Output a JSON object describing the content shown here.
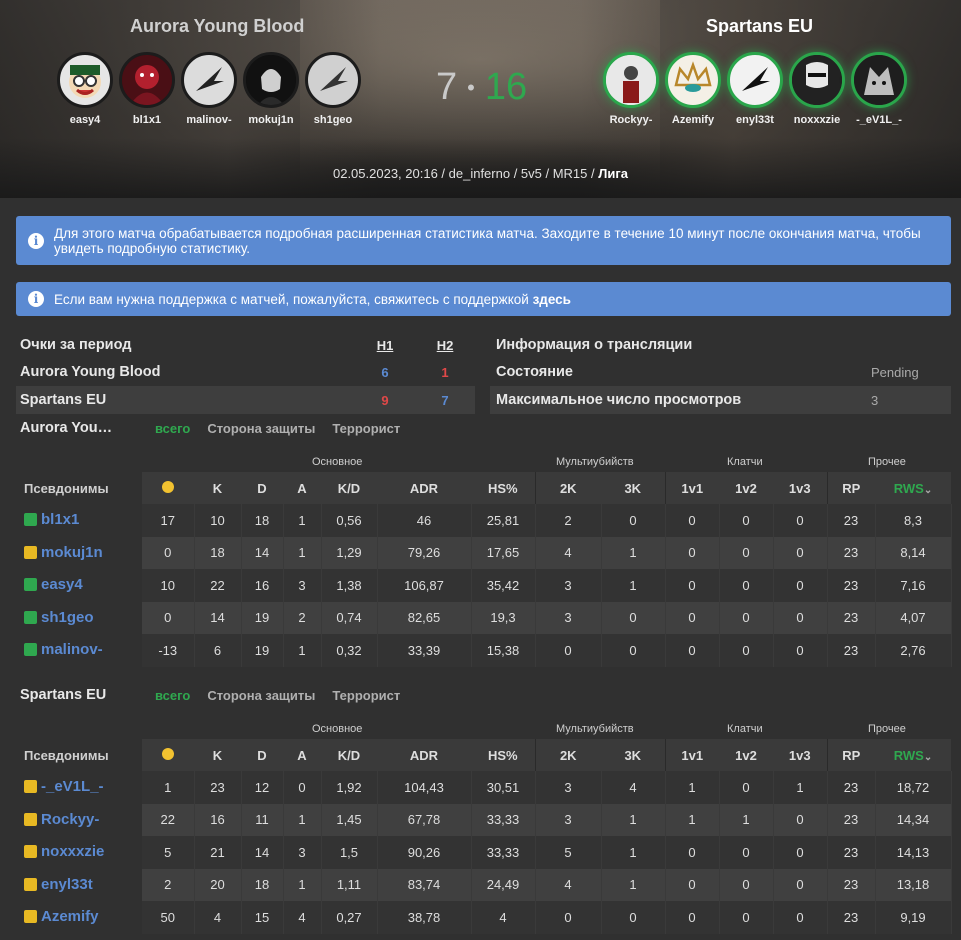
{
  "header": {
    "team_left": "Aurora Young Blood",
    "team_right": "Spartans EU",
    "score_left": "7",
    "score_sep": "•",
    "score_right": "16",
    "meta": "02.05.2023, 20:16 / de_inferno / 5v5 / MR15 / ",
    "meta_bold": "Лига",
    "players_left": [
      "easy4",
      "bl1x1",
      "malinov-",
      "mokuj1n",
      "sh1geo"
    ],
    "players_right": [
      "Rockyy-",
      "Azemify",
      "enyl33t",
      "noxxxzie",
      "-_eV1L_-"
    ]
  },
  "alerts": {
    "info_icon": "i",
    "stats_notice": "Для этого матча обрабатывается подробная расширенная статистика матча. Заходите в течение 10 минут после окончания матча, чтобы увидеть подробную статистику.",
    "support_text": "Если вам нужна поддержка с матчей, пожалуйста, свяжитесь с поддержкой ",
    "support_link": "здесь"
  },
  "period": {
    "title": "Очки за период",
    "h1": "H1",
    "h2": "H2",
    "rows": [
      {
        "team": "Aurora Young Blood",
        "h1": "6",
        "h2": "1"
      },
      {
        "team": "Spartans EU",
        "h1": "9",
        "h2": "7"
      }
    ]
  },
  "broadcast": {
    "title": "Информация о трансляции",
    "status_label": "Состояние",
    "status_value": "Pending",
    "views_label": "Максимальное число просмотров",
    "views_value": "3"
  },
  "table_labels": {
    "tab_all": "всего",
    "tab_ct": "Сторона защиты",
    "tab_t": "Террорист",
    "group_main": "Основное",
    "group_multi": "Мультиубийств",
    "group_clutch": "Клатчи",
    "group_other": "Прочее",
    "col_nick": "Псевдонимы",
    "col_k": "K",
    "col_d": "D",
    "col_a": "A",
    "col_kd": "K/D",
    "col_adr": "ADR",
    "col_hs": "HS%",
    "col_2k": "2K",
    "col_3k": "3K",
    "col_1v1": "1v1",
    "col_1v2": "1v2",
    "col_1v3": "1v3",
    "col_rp": "RP",
    "col_rws": "RWS",
    "sort_icon": "⌄"
  },
  "team1": {
    "name": "Aurora You…",
    "rows": [
      {
        "nick": "bl1x1",
        "rank": "green",
        "sm": "17",
        "k": "10",
        "d": "18",
        "a": "1",
        "kd": "0,56",
        "adr": "46",
        "hs": "25,81",
        "k2": "2",
        "k3": "0",
        "c1": "0",
        "c2": "0",
        "c3": "0",
        "rp": "23",
        "rws": "8,3"
      },
      {
        "nick": "mokuj1n",
        "rank": "yellow",
        "sm": "0",
        "k": "18",
        "d": "14",
        "a": "1",
        "kd": "1,29",
        "adr": "79,26",
        "hs": "17,65",
        "k2": "4",
        "k3": "1",
        "c1": "0",
        "c2": "0",
        "c3": "0",
        "rp": "23",
        "rws": "8,14"
      },
      {
        "nick": "easy4",
        "rank": "green",
        "sm": "10",
        "k": "22",
        "d": "16",
        "a": "3",
        "kd": "1,38",
        "adr": "106,87",
        "hs": "35,42",
        "k2": "3",
        "k3": "1",
        "c1": "0",
        "c2": "0",
        "c3": "0",
        "rp": "23",
        "rws": "7,16"
      },
      {
        "nick": "sh1geo",
        "rank": "green",
        "sm": "0",
        "k": "14",
        "d": "19",
        "a": "2",
        "kd": "0,74",
        "adr": "82,65",
        "hs": "19,3",
        "k2": "3",
        "k3": "0",
        "c1": "0",
        "c2": "0",
        "c3": "0",
        "rp": "23",
        "rws": "4,07"
      },
      {
        "nick": "malinov-",
        "rank": "green",
        "sm": "-13",
        "k": "6",
        "d": "19",
        "a": "1",
        "kd": "0,32",
        "adr": "33,39",
        "hs": "15,38",
        "k2": "0",
        "k3": "0",
        "c1": "0",
        "c2": "0",
        "c3": "0",
        "rp": "23",
        "rws": "2,76"
      }
    ]
  },
  "team2": {
    "name": "Spartans EU",
    "rows": [
      {
        "nick": "-_eV1L_-",
        "rank": "yellow",
        "sm": "1",
        "k": "23",
        "d": "12",
        "a": "0",
        "kd": "1,92",
        "adr": "104,43",
        "hs": "30,51",
        "k2": "3",
        "k3": "4",
        "c1": "1",
        "c2": "0",
        "c3": "1",
        "rp": "23",
        "rws": "18,72"
      },
      {
        "nick": "Rockyy-",
        "rank": "yellow",
        "sm": "22",
        "k": "16",
        "d": "11",
        "a": "1",
        "kd": "1,45",
        "adr": "67,78",
        "hs": "33,33",
        "k2": "3",
        "k3": "1",
        "c1": "1",
        "c2": "1",
        "c3": "0",
        "rp": "23",
        "rws": "14,34"
      },
      {
        "nick": "noxxxzie",
        "rank": "yellow",
        "sm": "5",
        "k": "21",
        "d": "14",
        "a": "3",
        "kd": "1,5",
        "adr": "90,26",
        "hs": "33,33",
        "k2": "5",
        "k3": "1",
        "c1": "0",
        "c2": "0",
        "c3": "0",
        "rp": "23",
        "rws": "14,13"
      },
      {
        "nick": "enyl33t",
        "rank": "yellow",
        "sm": "2",
        "k": "20",
        "d": "18",
        "a": "1",
        "kd": "1,11",
        "adr": "83,74",
        "hs": "24,49",
        "k2": "4",
        "k3": "1",
        "c1": "0",
        "c2": "0",
        "c3": "0",
        "rp": "23",
        "rws": "13,18"
      },
      {
        "nick": "Azemify",
        "rank": "yellow",
        "sm": "50",
        "k": "4",
        "d": "15",
        "a": "4",
        "kd": "0,27",
        "adr": "38,78",
        "hs": "4",
        "k2": "0",
        "k3": "0",
        "c1": "0",
        "c2": "0",
        "c3": "0",
        "rp": "23",
        "rws": "9,19"
      }
    ]
  },
  "colors": {
    "accent_blue": "#5b8ad2",
    "accent_green": "#2fa84f",
    "red": "#e04848",
    "rank_yellow": "#e8b923"
  }
}
